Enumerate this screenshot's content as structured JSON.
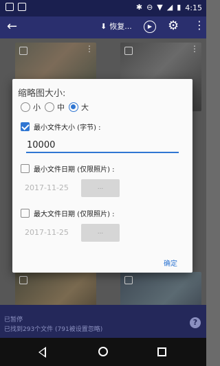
{
  "status_bar": {
    "time": "4:15"
  },
  "app_bar": {
    "restore_label": "恢复..."
  },
  "bottom": {
    "line1": "已暂停",
    "line2": "已找到293个文件 (791被设置忽略)",
    "help": "?"
  },
  "dialog": {
    "title": "缩略图大小:",
    "size_options": [
      {
        "label": "小",
        "selected": false
      },
      {
        "label": "中",
        "selected": false
      },
      {
        "label": "大",
        "selected": true
      }
    ],
    "min_size": {
      "label": "最小文件大小 (字节) :",
      "checked": true,
      "value": "10000"
    },
    "min_date": {
      "label": "最小文件日期 (仅限照片) :",
      "checked": false,
      "date": "2017-11-25",
      "button": "..."
    },
    "max_date": {
      "label": "最大文件日期 (仅限照片) :",
      "checked": false,
      "date": "2017-11-25",
      "button": "..."
    },
    "ok_label": "确定"
  },
  "colors": {
    "accent": "#2f76d2",
    "app_bar": "#2a2f6e",
    "status_bar": "#1a1f4f"
  }
}
